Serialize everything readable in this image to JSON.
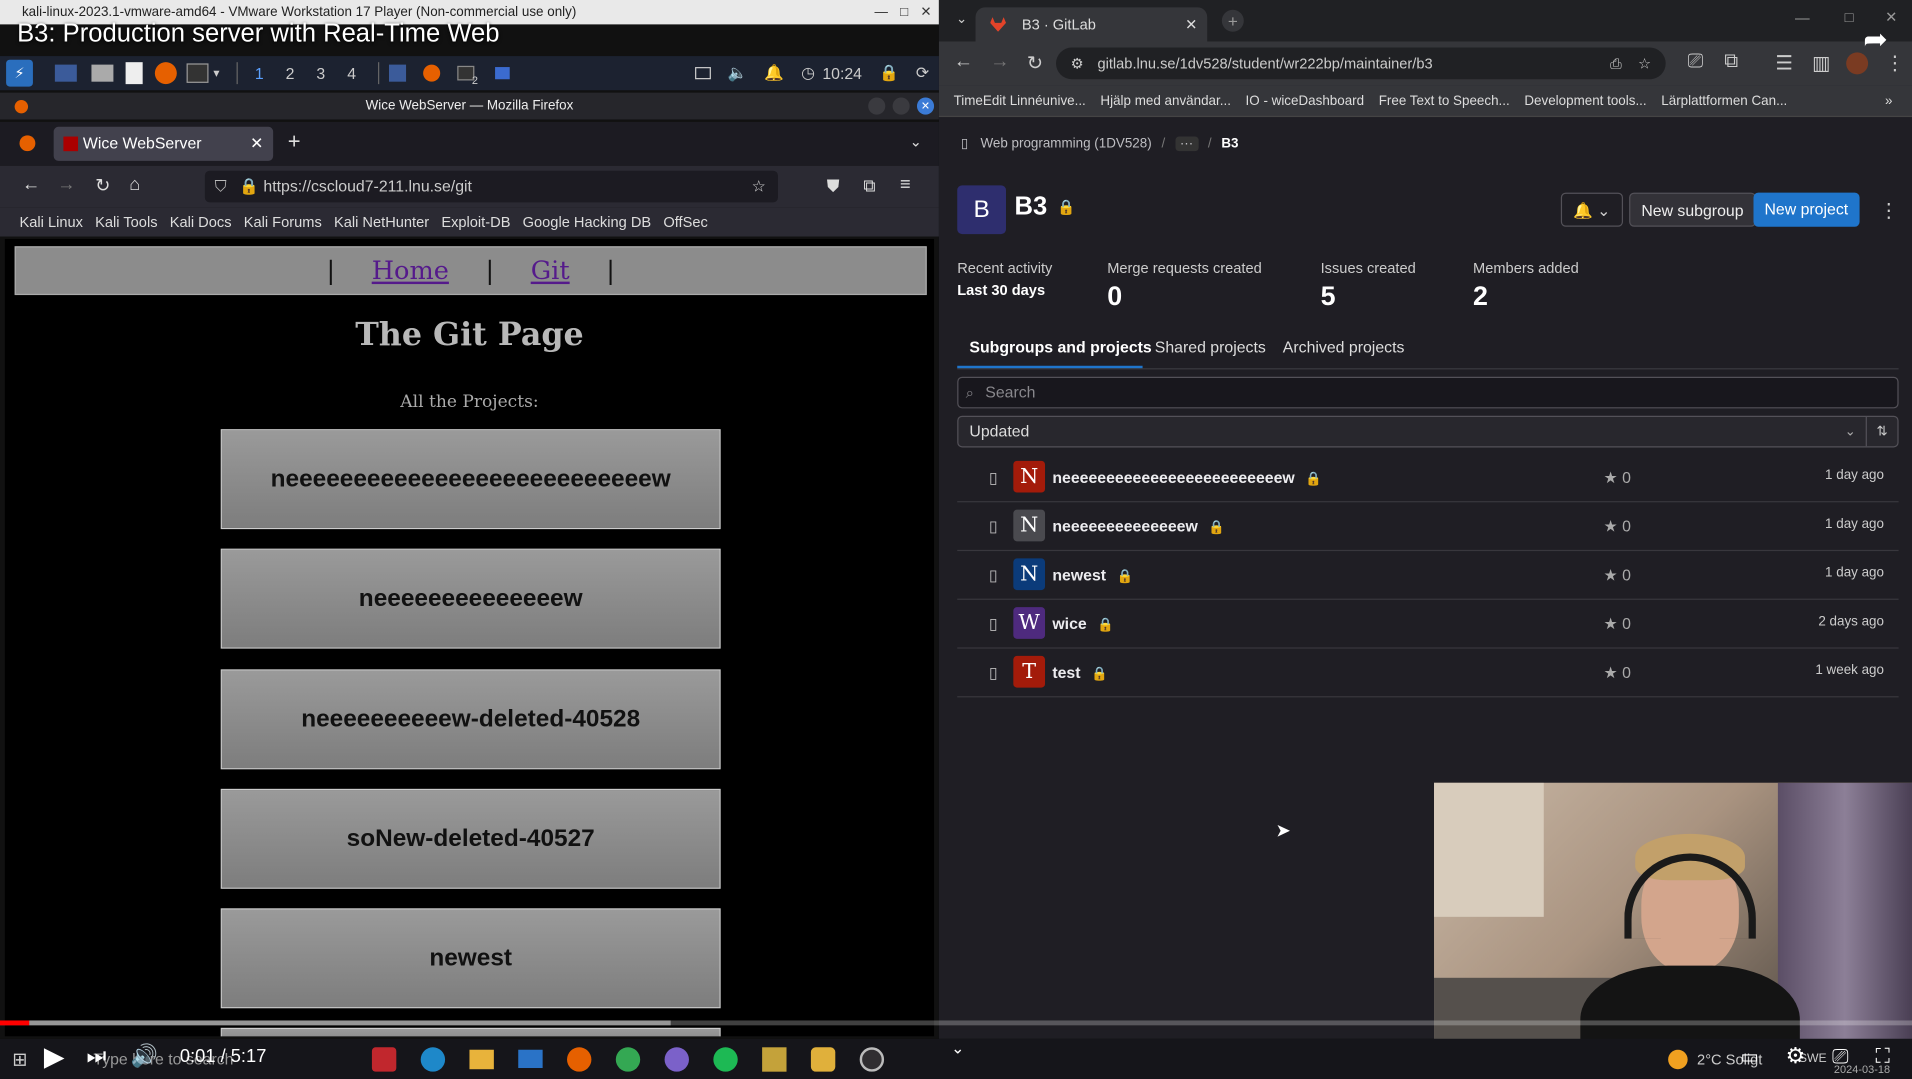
{
  "video": {
    "title": "B3: Production server with Real-Time Web",
    "time": "0:01 / 5:17"
  },
  "vm": {
    "window_title": "kali-linux-2023.1-vmware-amd64 - VMware Workstation 17 Player (Non-commercial use only)",
    "workspaces": [
      "1",
      "2",
      "3",
      "4"
    ],
    "clock": "10:24",
    "badge": "2"
  },
  "firefox": {
    "window_title": "Wice WebServer — Mozilla Firefox",
    "tab": "Wice WebServer",
    "url": "https://cscloud7-211.lnu.se/git",
    "bookmarks": [
      "Kali Linux",
      "Kali Tools",
      "Kali Docs",
      "Kali Forums",
      "Kali NetHunter",
      "Exploit-DB",
      "Google Hacking DB",
      "OffSec"
    ]
  },
  "site": {
    "nav": [
      "Home",
      "Git"
    ],
    "heading": "The Git Page",
    "subheading": "All the Projects:",
    "projects": [
      "neeeeeeeeeeeeeeeeeeeeeeeeeeew",
      "neeeeeeeeeeeeeew",
      "neeeeeeeeeew-deleted-40528",
      "soNew-deleted-40527",
      "newest"
    ]
  },
  "chrome": {
    "tab": "B3 · GitLab",
    "url": "gitlab.lnu.se/1dv528/student/wr222bp/maintainer/b3",
    "bookmarks": [
      "TimeEdit Linnéunive...",
      "Hjälp med användar...",
      "IO - wiceDashboard",
      "Free Text to Speech...",
      "Development tools...",
      "Lärplattformen Can..."
    ]
  },
  "gitlab": {
    "breadcrumb": [
      "Web programming (1DV528)",
      "···",
      "B3"
    ],
    "group_initial": "B",
    "group_name": "B3",
    "buttons": {
      "new_subgroup": "New subgroup",
      "new_project": "New project"
    },
    "stats": {
      "recent": "Recent activity",
      "period": "Last 30 days",
      "items": [
        {
          "label": "Merge requests created",
          "value": "0"
        },
        {
          "label": "Issues created",
          "value": "5"
        },
        {
          "label": "Members added",
          "value": "2"
        }
      ]
    },
    "tabs": [
      "Subgroups and projects",
      "Shared projects",
      "Archived projects"
    ],
    "search_placeholder": "Search",
    "sort": "Updated",
    "projects": [
      {
        "initial": "N",
        "name": "neeeeeeeeeeeeeeeeeeeeeeeeew",
        "stars": "0",
        "updated": "1 day ago",
        "color": "#a31b0a"
      },
      {
        "initial": "N",
        "name": "neeeeeeeeeeeeeew",
        "stars": "0",
        "updated": "1 day ago",
        "color": "#4a4a4f"
      },
      {
        "initial": "N",
        "name": "newest",
        "stars": "0",
        "updated": "1 day ago",
        "color": "#0b3b7a"
      },
      {
        "initial": "W",
        "name": "wice",
        "stars": "0",
        "updated": "2 days ago",
        "color": "#4e2a7e"
      },
      {
        "initial": "T",
        "name": "test",
        "stars": "0",
        "updated": "1 week ago",
        "color": "#a31b0a"
      }
    ]
  },
  "taskbar": {
    "search": "Type here to search",
    "weather": "2°C Soligt",
    "lang": "SWE",
    "date": "2024-03-18"
  },
  "colors": {
    "accent": "#1f75cb",
    "red": "#ff0000"
  }
}
